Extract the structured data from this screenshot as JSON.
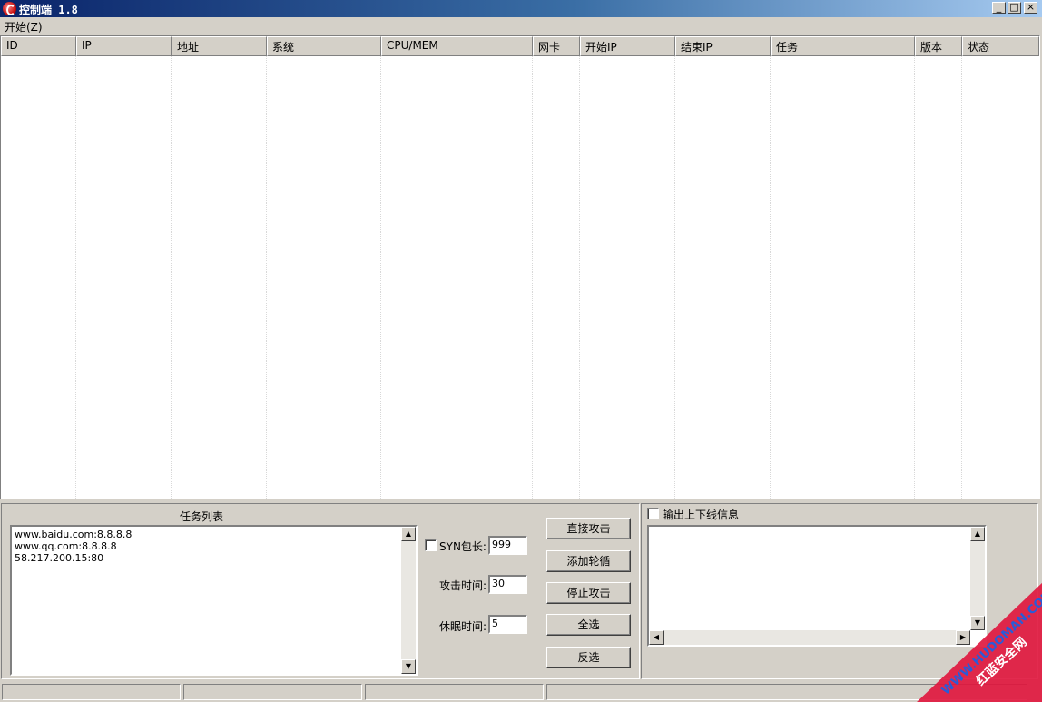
{
  "window": {
    "title": "控制端 1.8",
    "minimize_glyph": "_",
    "maximize_glyph": "□",
    "close_glyph": "×"
  },
  "menu": {
    "items": [
      {
        "label": "开始(Z)"
      }
    ]
  },
  "list": {
    "columns": [
      "ID",
      "IP",
      "地址",
      "系统",
      "CPU/MEM",
      "网卡",
      "开始IP",
      "结束IP",
      "任务",
      "版本",
      "状态"
    ],
    "rows": []
  },
  "task_panel": {
    "title": "任务列表",
    "tasks": [
      "www.baidu.com:8.8.8.8",
      "www.qq.com:8.8.8.8",
      "58.217.200.15:80"
    ]
  },
  "settings": {
    "syn_checkbox_label": "SYN包长:",
    "syn_checked": false,
    "syn_value": "999",
    "attack_time_label": "攻击时间:",
    "attack_time_value": "30",
    "sleep_time_label": "休眠时间:",
    "sleep_time_value": "5"
  },
  "buttons": {
    "direct_attack": "直接攻击",
    "add_rotation": "添加轮循",
    "stop_attack": "停止攻击",
    "select_all": "全选",
    "invert_selection": "反选"
  },
  "log_panel": {
    "checkbox_label": "输出上下线信息",
    "checked": false,
    "content": ""
  },
  "watermark": {
    "url_text": "WWW.HUDOMAN.COM",
    "name_text": "红蓝安全网",
    "color": "#e0143c"
  },
  "colors": {
    "title_start": "#0a246a",
    "title_end": "#a6caf0",
    "face": "#d4d0c8"
  }
}
